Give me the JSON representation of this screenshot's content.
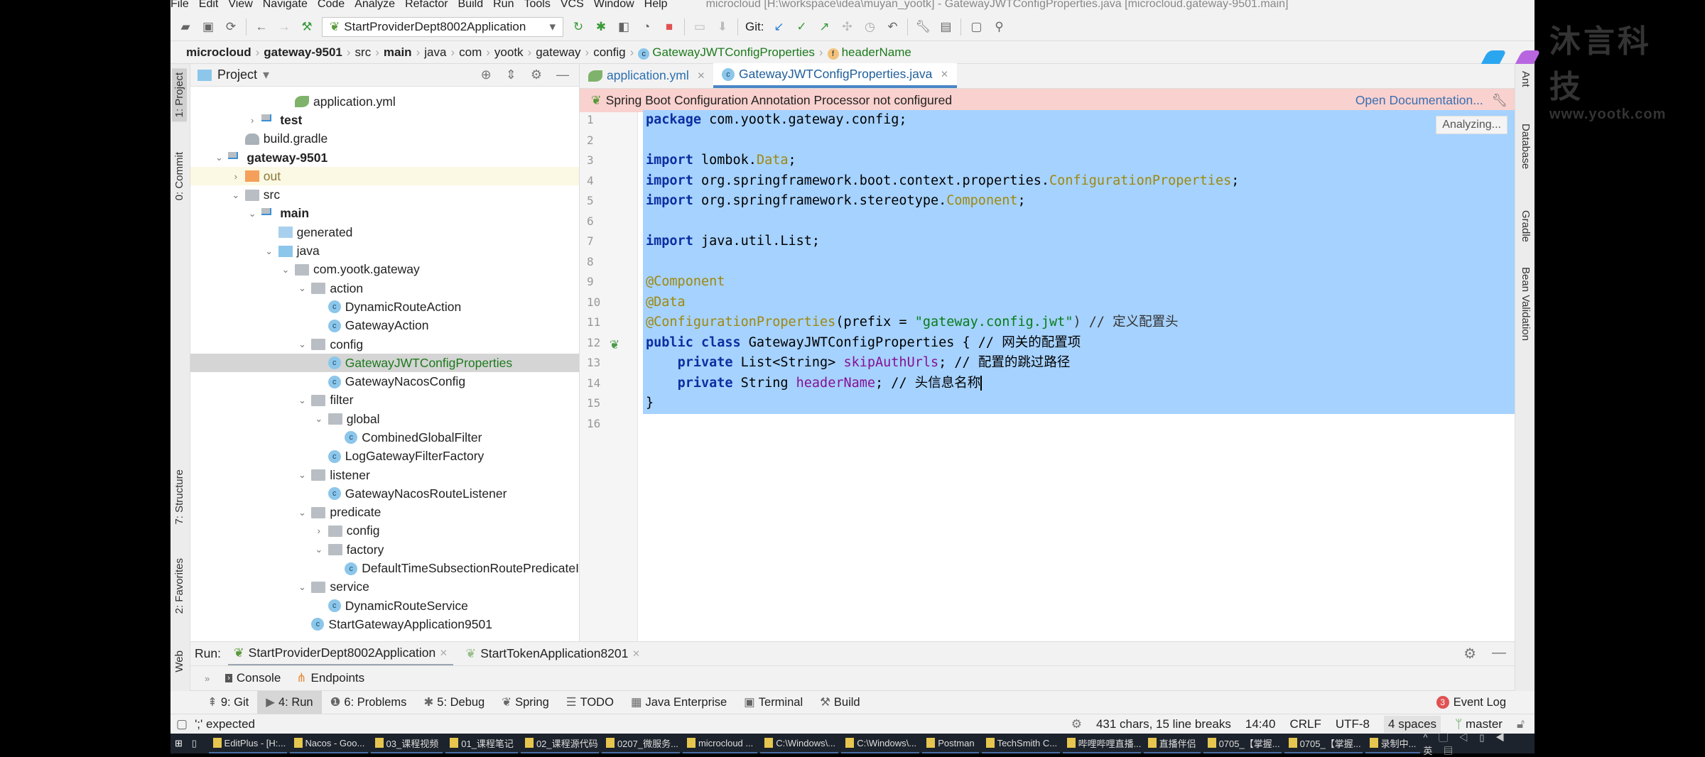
{
  "window": {
    "title": "microcloud [H:\\workspace\\idea\\muyan_yootk] - GatewayJWTConfigProperties.java [microcloud.gateway-9501.main]"
  },
  "menu": [
    "File",
    "Edit",
    "View",
    "Navigate",
    "Code",
    "Analyze",
    "Refactor",
    "Build",
    "Run",
    "Tools",
    "VCS",
    "Window",
    "Help"
  ],
  "toolbar": {
    "run_config": "StartProviderDept8002Application",
    "git_label": "Git:"
  },
  "breadcrumb": [
    "microcloud",
    "gateway-9501",
    "src",
    "main",
    "java",
    "com",
    "yootk",
    "gateway",
    "config",
    "GatewayJWTConfigProperties",
    "headerName"
  ],
  "left_strip": [
    "1: Project",
    "0: Commit",
    "7: Structure",
    "2: Favorites",
    "Web"
  ],
  "right_strip": [
    "Ant",
    "Database",
    "Gradle",
    "Bean Validation"
  ],
  "project": {
    "title": "Project",
    "tree": [
      {
        "label": "application.yml",
        "level": 5,
        "icon": "yml",
        "arrow": ""
      },
      {
        "label": "test",
        "level": 3,
        "icon": "src",
        "arrow": "right",
        "bold": true
      },
      {
        "label": "build.gradle",
        "level": 2,
        "icon": "gradle",
        "arrow": ""
      },
      {
        "label": "gateway-9501",
        "level": 1,
        "icon": "src",
        "arrow": "down",
        "bold": true
      },
      {
        "label": "out",
        "level": 2,
        "icon": "out",
        "arrow": "right",
        "highlight": true
      },
      {
        "label": "src",
        "level": 2,
        "icon": "folder",
        "arrow": "down"
      },
      {
        "label": "main",
        "level": 3,
        "icon": "src",
        "arrow": "down",
        "bold": true
      },
      {
        "label": "generated",
        "level": 4,
        "icon": "gen",
        "arrow": ""
      },
      {
        "label": "java",
        "level": 4,
        "icon": "java",
        "arrow": "down"
      },
      {
        "label": "com.yootk.gateway",
        "level": 5,
        "icon": "folder",
        "arrow": "down"
      },
      {
        "label": "action",
        "level": 6,
        "icon": "folder",
        "arrow": "down"
      },
      {
        "label": "DynamicRouteAction",
        "level": 7,
        "icon": "class",
        "arrow": ""
      },
      {
        "label": "GatewayAction",
        "level": 7,
        "icon": "class",
        "arrow": ""
      },
      {
        "label": "config",
        "level": 6,
        "icon": "folder",
        "arrow": "down"
      },
      {
        "label": "GatewayJWTConfigProperties",
        "level": 7,
        "icon": "class",
        "arrow": "",
        "selected": true
      },
      {
        "label": "GatewayNacosConfig",
        "level": 7,
        "icon": "class",
        "arrow": ""
      },
      {
        "label": "filter",
        "level": 6,
        "icon": "folder",
        "arrow": "down"
      },
      {
        "label": "global",
        "level": 7,
        "icon": "folder",
        "arrow": "down"
      },
      {
        "label": "CombinedGlobalFilter",
        "level": 8,
        "icon": "class",
        "arrow": ""
      },
      {
        "label": "LogGatewayFilterFactory",
        "level": 7,
        "icon": "class",
        "arrow": ""
      },
      {
        "label": "listener",
        "level": 6,
        "icon": "folder",
        "arrow": "down"
      },
      {
        "label": "GatewayNacosRouteListener",
        "level": 7,
        "icon": "class",
        "arrow": ""
      },
      {
        "label": "predicate",
        "level": 6,
        "icon": "folder",
        "arrow": "down"
      },
      {
        "label": "config",
        "level": 7,
        "icon": "folder",
        "arrow": "right"
      },
      {
        "label": "factory",
        "level": 7,
        "icon": "folder",
        "arrow": "down"
      },
      {
        "label": "DefaultTimeSubsectionRoutePredicateI",
        "level": 8,
        "icon": "class",
        "arrow": ""
      },
      {
        "label": "service",
        "level": 6,
        "icon": "folder",
        "arrow": "down"
      },
      {
        "label": "DynamicRouteService",
        "level": 7,
        "icon": "class",
        "arrow": ""
      },
      {
        "label": "StartGatewayApplication9501",
        "level": 6,
        "icon": "class",
        "arrow": ""
      }
    ]
  },
  "editor": {
    "tabs": [
      {
        "label": "application.yml",
        "active": false
      },
      {
        "label": "GatewayJWTConfigProperties.java",
        "active": true
      }
    ],
    "banner": {
      "text": "Spring Boot Configuration Annotation Processor not configured",
      "link": "Open Documentation..."
    },
    "status": "Analyzing...",
    "lines": [
      [
        [
          "package",
          "k"
        ],
        [
          " com.yootk.gateway.config;",
          "p"
        ]
      ],
      [],
      [
        [
          "import",
          "k"
        ],
        [
          " lombok.",
          "p"
        ],
        [
          "Data",
          "a"
        ],
        [
          ";",
          "p"
        ]
      ],
      [
        [
          "import",
          "k"
        ],
        [
          " org.springframework.boot.context.properties.",
          "p"
        ],
        [
          "ConfigurationProperties",
          "a"
        ],
        [
          ";",
          "p"
        ]
      ],
      [
        [
          "import",
          "k"
        ],
        [
          " org.springframework.stereotype.",
          "p"
        ],
        [
          "Component",
          "a"
        ],
        [
          ";",
          "p"
        ]
      ],
      [],
      [
        [
          "import",
          "k"
        ],
        [
          " java.util.List;",
          "p"
        ]
      ],
      [],
      [
        [
          "@Component",
          "a"
        ]
      ],
      [
        [
          "@Data",
          "a"
        ]
      ],
      [
        [
          "@ConfigurationProperties",
          "a"
        ],
        [
          "(prefix = ",
          "p"
        ],
        [
          "\"gateway.config.jwt\"",
          "s"
        ],
        [
          ") // 定义配置头",
          "cm"
        ]
      ],
      [
        [
          "public class",
          "k"
        ],
        [
          " GatewayJWTConfigProperties { // 网关的配置项",
          "p"
        ]
      ],
      [
        [
          "    "
        ],
        [
          "private",
          "k"
        ],
        [
          " List<String> ",
          "p"
        ],
        [
          "skipAuthUrls",
          "f"
        ],
        [
          "; // 配置的跳过路径",
          "p"
        ]
      ],
      [
        [
          "    "
        ],
        [
          "private",
          "k"
        ],
        [
          " String ",
          "p"
        ],
        [
          "headerName",
          "f"
        ],
        [
          "; // 头信息名称",
          "p"
        ]
      ],
      [
        [
          "}",
          "p"
        ]
      ],
      []
    ],
    "selected_lines": 15
  },
  "run": {
    "label": "Run:",
    "tabs": [
      "StartProviderDept8002Application",
      "StartTokenApplication8201"
    ],
    "subtabs": [
      "Console",
      "Endpoints"
    ]
  },
  "bottom_tabs": [
    {
      "label": "9: Git"
    },
    {
      "label": "4: Run",
      "active": true
    },
    {
      "label": "6: Problems"
    },
    {
      "label": "5: Debug"
    },
    {
      "label": "Spring"
    },
    {
      "label": "TODO"
    },
    {
      "label": "Java Enterprise"
    },
    {
      "label": "Terminal"
    },
    {
      "label": "Build"
    }
  ],
  "event_log": {
    "count": "3",
    "label": "Event Log"
  },
  "status": {
    "message": "';' expected",
    "chars": "431 chars, 15 line breaks",
    "position": "14:40",
    "line_sep": "CRLF",
    "encoding": "UTF-8",
    "indent": "4 spaces",
    "branch": "master"
  },
  "taskbar": [
    "EditPlus - [H:...",
    "Nacos - Goo...",
    "03_课程视频",
    "01_课程笔记",
    "02_课程源代码",
    "0207_微服务...",
    "microcloud ...",
    "C:\\Windows\\...",
    "C:\\Windows\\...",
    "Postman",
    "TechSmith C...",
    "哔哩哔哩直播...",
    "直播伴侣",
    "0705_【掌握...",
    "0705_【掌握...",
    "录制中..."
  ],
  "watermark": {
    "cn": "沐言科技",
    "url": "www.yootk.com"
  },
  "colors": {
    "selection": "#a6d2ff",
    "banner": "#f9d1ce",
    "keyword": "#0b2fa0",
    "annotation": "#9e880d",
    "string": "#067d17",
    "field": "#871094"
  }
}
